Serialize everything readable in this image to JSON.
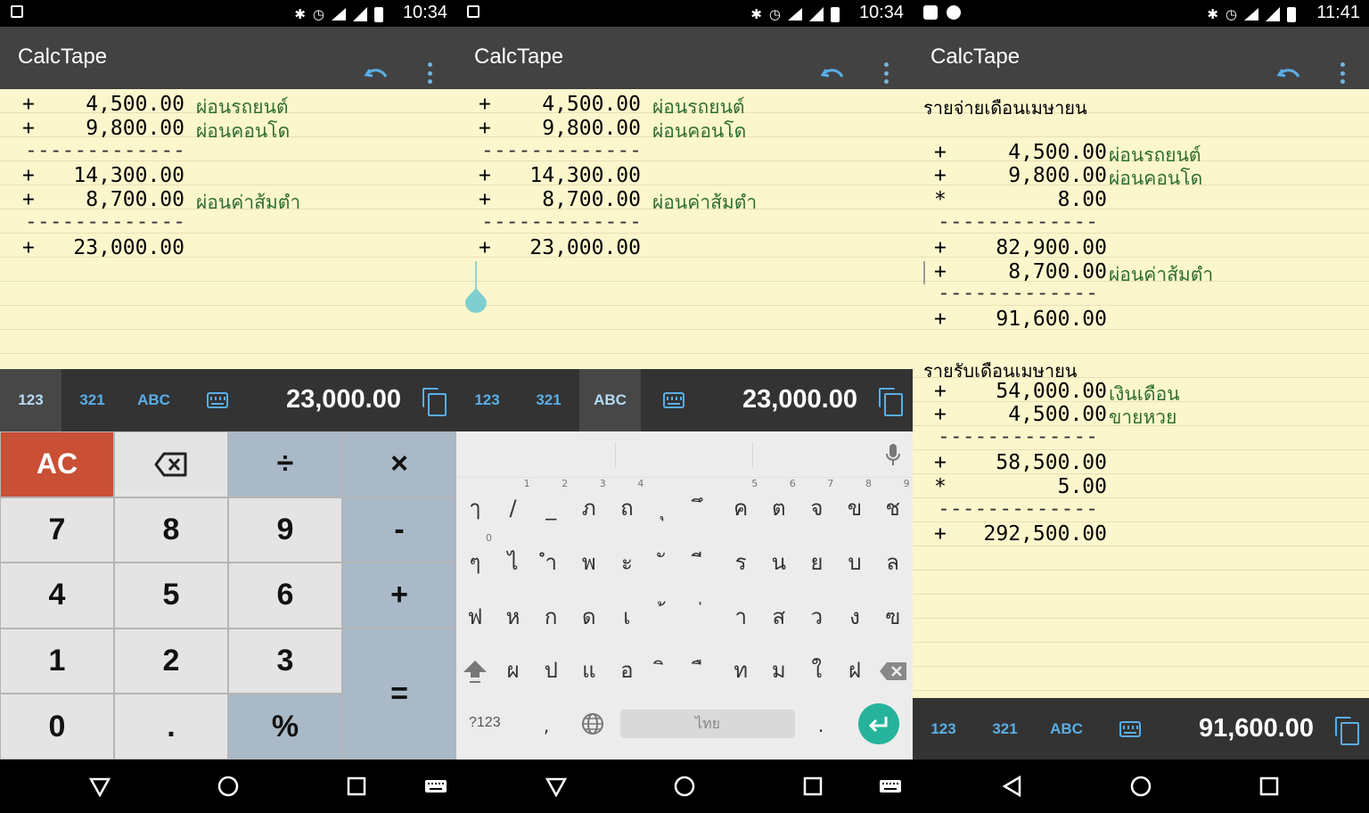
{
  "app": {
    "title": "CalcTape"
  },
  "panel1": {
    "status_time": "10:34",
    "tape": [
      {
        "op": "+",
        "num": "4,500.00",
        "note": "ผ่อนรถยนต์"
      },
      {
        "op": "+",
        "num": "9,800.00",
        "note": "ผ่อนคอนโด"
      },
      {
        "dash": "-------------"
      },
      {
        "op": "+",
        "num": "14,300.00",
        "note": ""
      },
      {
        "op": "+",
        "num": "8,700.00",
        "note": "ผ่อนค่าส้มตำ"
      },
      {
        "dash": "-------------"
      },
      {
        "op": "+",
        "num": "23,000.00",
        "note": ""
      }
    ],
    "modes": [
      "123",
      "321",
      "ABC"
    ],
    "active_mode": "123",
    "display": "23,000.00",
    "keypad": {
      "ac": "AC",
      "div": "÷",
      "mul": "×",
      "k7": "7",
      "k8": "8",
      "k9": "9",
      "minus": "-",
      "k4": "4",
      "k5": "5",
      "k6": "6",
      "plus": "+",
      "k1": "1",
      "k2": "2",
      "k3": "3",
      "equals": "=",
      "k0": "0",
      "dot": ".",
      "percent": "%"
    }
  },
  "panel2": {
    "status_time": "10:34",
    "tape": [
      {
        "op": "+",
        "num": "4,500.00",
        "note": "ผ่อนรถยนต์"
      },
      {
        "op": "+",
        "num": "9,800.00",
        "note": "ผ่อนคอนโด"
      },
      {
        "dash": "-------------"
      },
      {
        "op": "+",
        "num": "14,300.00",
        "note": ""
      },
      {
        "op": "+",
        "num": "8,700.00",
        "note": "ผ่อนค่าส้มตำ"
      },
      {
        "dash": "-------------"
      },
      {
        "op": "+",
        "num": "23,000.00",
        "note": ""
      }
    ],
    "modes": [
      "123",
      "321",
      "ABC"
    ],
    "active_mode": "ABC",
    "display": "23,000.00",
    "keyboard": {
      "row1": [
        {
          "k": "ๅ",
          "h": ""
        },
        {
          "k": "/",
          "h": "1"
        },
        {
          "k": "_",
          "h": "2"
        },
        {
          "k": "ภ",
          "h": "3"
        },
        {
          "k": "ถ",
          "h": "4"
        },
        {
          "k": "ุ",
          "h": ""
        },
        {
          "k": "ึ",
          "h": ""
        },
        {
          "k": "ค",
          "h": "5"
        },
        {
          "k": "ต",
          "h": "6"
        },
        {
          "k": "จ",
          "h": "7"
        },
        {
          "k": "ข",
          "h": "8"
        },
        {
          "k": "ช",
          "h": "9"
        }
      ],
      "row2": [
        {
          "k": "ๆ",
          "h": "0"
        },
        {
          "k": "ไ",
          "h": ""
        },
        {
          "k": "ำ",
          "h": ""
        },
        {
          "k": "พ",
          "h": ""
        },
        {
          "k": "ะ",
          "h": ""
        },
        {
          "k": "ั",
          "h": ""
        },
        {
          "k": "ี",
          "h": ""
        },
        {
          "k": "ร",
          "h": ""
        },
        {
          "k": "น",
          "h": ""
        },
        {
          "k": "ย",
          "h": ""
        },
        {
          "k": "บ",
          "h": ""
        },
        {
          "k": "ล",
          "h": ""
        }
      ],
      "row3": [
        {
          "k": "ฟ",
          "h": ""
        },
        {
          "k": "ห",
          "h": ""
        },
        {
          "k": "ก",
          "h": ""
        },
        {
          "k": "ด",
          "h": ""
        },
        {
          "k": "เ",
          "h": ""
        },
        {
          "k": "้",
          "h": ""
        },
        {
          "k": "่",
          "h": ""
        },
        {
          "k": "า",
          "h": ""
        },
        {
          "k": "ส",
          "h": ""
        },
        {
          "k": "ว",
          "h": ""
        },
        {
          "k": "ง",
          "h": ""
        },
        {
          "k": "ฃ",
          "h": ""
        }
      ],
      "row4": [
        {
          "k": "ผ",
          "h": ""
        },
        {
          "k": "ป",
          "h": ""
        },
        {
          "k": "แ",
          "h": ""
        },
        {
          "k": "อ",
          "h": ""
        },
        {
          "k": "ิ",
          "h": ""
        },
        {
          "k": "ื",
          "h": ""
        },
        {
          "k": "ท",
          "h": ""
        },
        {
          "k": "ม",
          "h": ""
        },
        {
          "k": "ใ",
          "h": ""
        },
        {
          "k": "ฝ",
          "h": ""
        }
      ],
      "sym_label": "?123",
      "comma": ",",
      "space_label": "ไทย",
      "period": "."
    }
  },
  "panel3": {
    "status_time": "11:41",
    "tape": [
      {
        "heading": "รายจ่ายเดือนเมษายน"
      },
      {
        "blank": true
      },
      {
        "op": "+",
        "num": "4,500.00",
        "note": "ผ่อนรถยนต์"
      },
      {
        "op": "+",
        "num": "9,800.00",
        "note": "ผ่อนคอนโด"
      },
      {
        "op": "*",
        "num": "8.00",
        "note": ""
      },
      {
        "dash": "-------------"
      },
      {
        "op": "+",
        "num": "82,900.00",
        "note": ""
      },
      {
        "op": "+",
        "num": "8,700.00",
        "note": "ผ่อนค่าส้มตำ"
      },
      {
        "dash": "-------------"
      },
      {
        "op": "+",
        "num": "91,600.00",
        "note": ""
      },
      {
        "blank": true
      },
      {
        "heading": "รายรับเดือนเมษายน"
      },
      {
        "op": "+",
        "num": "54,000.00",
        "note": "เงินเดือน"
      },
      {
        "op": "+",
        "num": "4,500.00",
        "note": "ขายหวย"
      },
      {
        "dash": "-------------"
      },
      {
        "op": "+",
        "num": "58,500.00",
        "note": ""
      },
      {
        "op": "*",
        "num": "5.00",
        "note": ""
      },
      {
        "dash": "-------------"
      },
      {
        "op": "+",
        "num": "292,500.00",
        "note": ""
      }
    ],
    "modes": [
      "123",
      "321",
      "ABC"
    ],
    "active_mode": "",
    "display": "91,600.00"
  },
  "colors": {
    "accent": "#5aaee6",
    "appbar": "#424242",
    "paper": "#fcf6cd",
    "note": "#2e6e2e",
    "ac": "#c94f35",
    "op_key": "#a9b9c7",
    "enter": "#26b39b"
  }
}
